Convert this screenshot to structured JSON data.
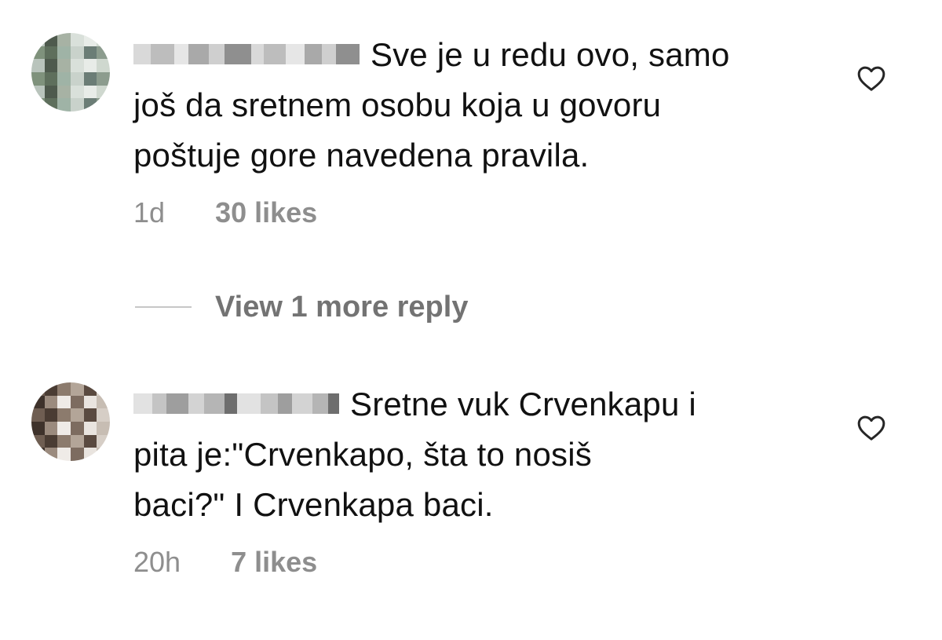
{
  "comments": [
    {
      "text": "Sve je u redu ovo, samo još da sretnem osobu koja u govoru poštuje gore navedena pravila.",
      "lines": [
        "Sve je u redu ovo, samo",
        "još da sretnem osobu koja u govoru",
        "poštuje gore navedena pravila."
      ],
      "time": "1d",
      "likes": "30 likes",
      "username": "blurred",
      "avatar": "blurred-photo"
    },
    {
      "text": "Sretne vuk Crvenkapu i pita je:\"Crvenkapo, šta to nosiš baci?\" I Crvenkapa baci.",
      "lines": [
        "Sretne vuk Crvenkapu i",
        "pita je:\"Crvenkapo, šta to nosiš",
        "baci?\" I Crvenkapa baci."
      ],
      "time": "20h",
      "likes": "7 likes",
      "username": "blurred",
      "avatar": "blurred-photo"
    }
  ],
  "view_replies": {
    "label": "View 1 more reply"
  },
  "icons": {
    "like": "heart-icon"
  },
  "colors": {
    "text": "#111111",
    "meta": "#8e8e8e",
    "reply_label": "#737373",
    "divider": "#c7c7c7"
  }
}
